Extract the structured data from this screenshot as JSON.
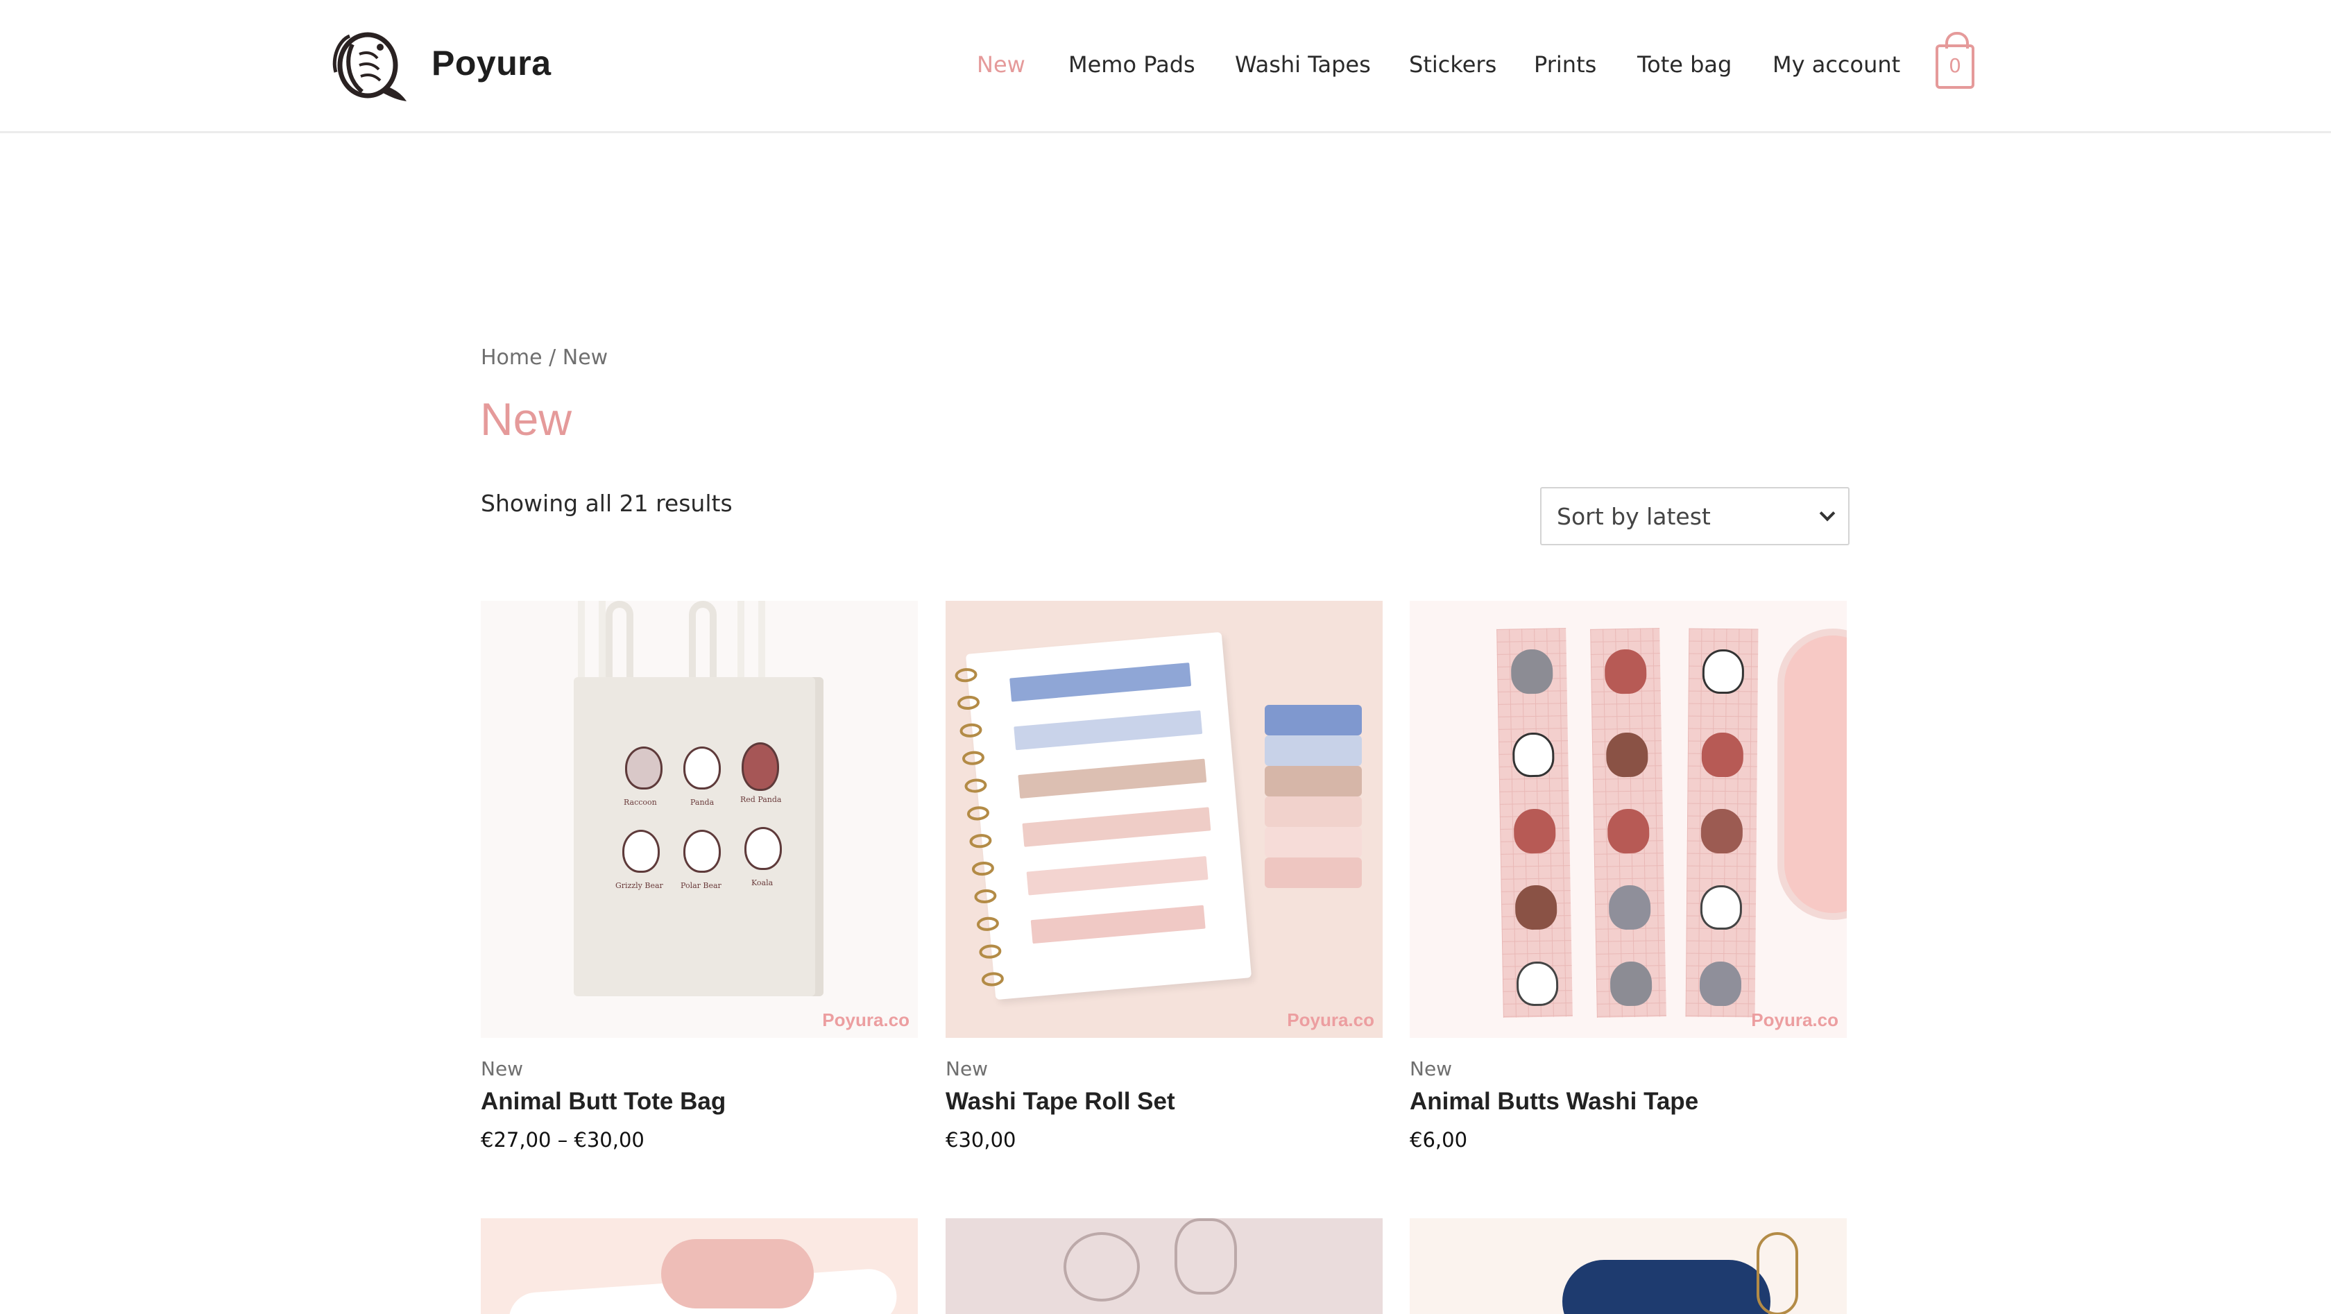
{
  "brand": {
    "name": "Poyura"
  },
  "nav": {
    "items": [
      {
        "label": "New",
        "active": true
      },
      {
        "label": "Memo Pads",
        "active": false
      },
      {
        "label": "Washi Tapes",
        "active": false
      },
      {
        "label": "Stickers",
        "active": false
      },
      {
        "label": "Prints",
        "active": false
      },
      {
        "label": "Tote bag",
        "active": false
      },
      {
        "label": "My account",
        "active": false
      }
    ],
    "cart_count": "0"
  },
  "breadcrumb": {
    "home": "Home",
    "separator": " / ",
    "current": "New"
  },
  "page": {
    "title": "New",
    "result_count": "Showing all 21 results",
    "sort_selected": "Sort by latest"
  },
  "products": [
    {
      "category": "New",
      "title": "Animal Butt Tote Bag",
      "price": "€27,00 – €30,00",
      "watermark": "Poyura.co",
      "art_labels": [
        "Raccoon",
        "Panda",
        "Red Panda",
        "Grizzly Bear",
        "Polar Bear",
        "Koala"
      ]
    },
    {
      "category": "New",
      "title": "Washi Tape Roll Set",
      "price": "€30,00",
      "watermark": "Poyura.co"
    },
    {
      "category": "New",
      "title": "Animal Butts Washi Tape",
      "price": "€6,00",
      "watermark": "Poyura.co"
    }
  ],
  "colors": {
    "accent": "#e59a9a",
    "text": "#222222",
    "muted": "#6f6f6f"
  }
}
